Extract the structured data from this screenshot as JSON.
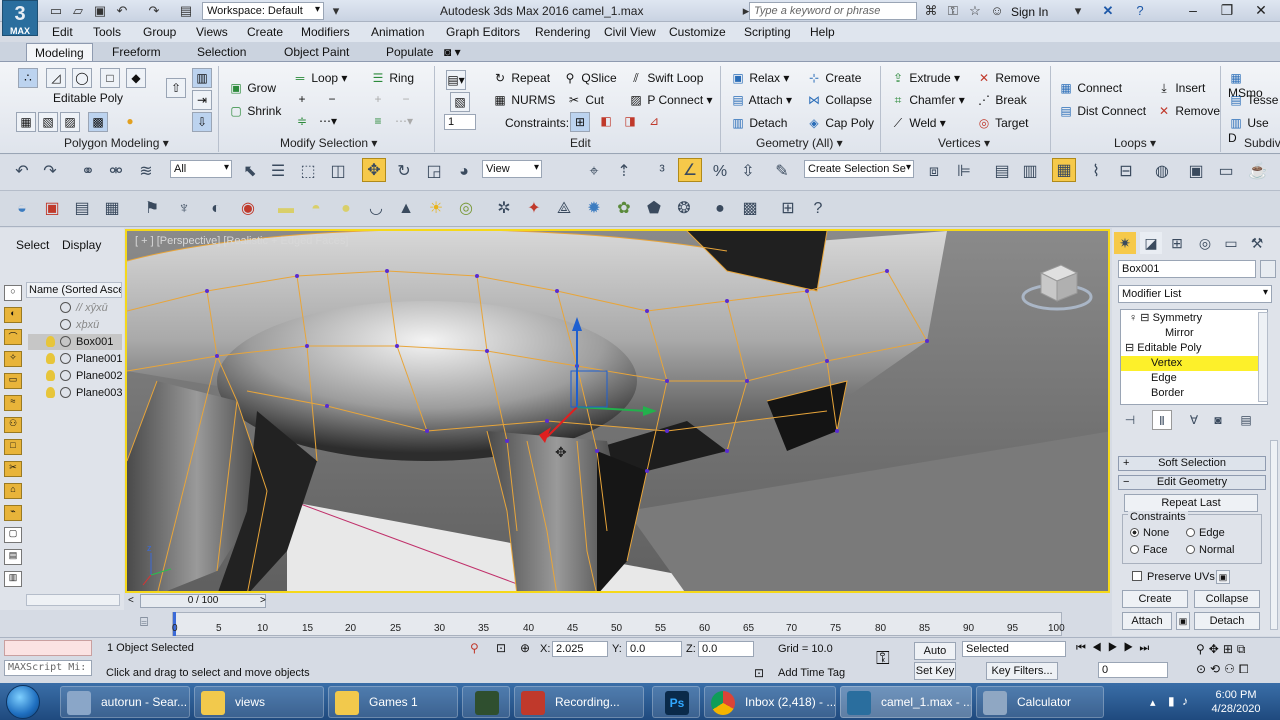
{
  "app": {
    "logo_text": "MAX",
    "window_title": "Autodesk 3ds Max 2016     camel_1.max"
  },
  "quick_access": {
    "workspace": "Workspace: Default"
  },
  "title_right": {
    "search_placeholder": "Type a keyword or phrase",
    "sign_in": "Sign In"
  },
  "menu": [
    "Edit",
    "Tools",
    "Group",
    "Views",
    "Create",
    "Modifiers",
    "Animation",
    "Graph Editors",
    "Rendering",
    "Civil View",
    "Customize",
    "Scripting",
    "Help"
  ],
  "ribbon_tabs": [
    "Modeling",
    "Freeform",
    "Selection",
    "Object Paint",
    "Populate"
  ],
  "ribbon": {
    "editable_poly": "Editable Poly",
    "grow": "Grow",
    "shrink": "Shrink",
    "loop": "Loop",
    "ring": "Ring",
    "spinner_value": "1",
    "repeat": "Repeat",
    "qslice": "QSlice",
    "swift_loop": "Swift Loop",
    "nurms": "NURMS",
    "cut": "Cut",
    "p_connect": "P Connect",
    "constraints": "Constraints:",
    "relax": "Relax",
    "create": "Create",
    "attach": "Attach",
    "collapse": "Collapse",
    "detach": "Detach",
    "cap_poly": "Cap Poly",
    "extrude": "Extrude",
    "remove": "Remove",
    "chamfer": "Chamfer",
    "break": "Break",
    "weld": "Weld",
    "target": "Target",
    "connect": "Connect",
    "dist_connect": "Dist Connect",
    "insert": "Insert",
    "remove2": "Remove",
    "msmooth": "MSmo",
    "tessellate": "Tesse",
    "use_d": "Use D"
  },
  "ribbon_groups": [
    "Polygon Modeling",
    "Modify Selection",
    "Edit",
    "Geometry (All)",
    "Vertices",
    "Loops",
    "Subdiv"
  ],
  "toolbar": {
    "filter": "All",
    "ref_coord": "View",
    "named_sel": "Create Selection Se"
  },
  "left_panel": {
    "tab_select": "Select",
    "tab_display": "Display",
    "name_header": "Name (Sorted Ascen",
    "items": [
      "// xŷxū",
      "xþxū",
      "Box001",
      "Plane001",
      "Plane002",
      "Plane003"
    ]
  },
  "viewport": {
    "label": "[ + ] [Perspective] [Realistic + Edged Faces]"
  },
  "command_panel": {
    "object_name": "Box001",
    "modifier_list": "Modifier List",
    "stack": [
      "Symmetry",
      "Mirror",
      "Editable Poly",
      "Vertex",
      "Edge",
      "Border"
    ],
    "soft_selection": "Soft Selection",
    "edit_geometry": "Edit Geometry",
    "repeat_last": "Repeat Last",
    "constraints_label": "Constraints",
    "c_none": "None",
    "c_edge": "Edge",
    "c_face": "Face",
    "c_normal": "Normal",
    "preserve_uvs": "Preserve UVs",
    "create": "Create",
    "collapse": "Collapse",
    "attach": "Attach",
    "detach": "Detach"
  },
  "timeline": {
    "slider": "0 / 100",
    "ticks": [
      "0",
      "5",
      "10",
      "15",
      "20",
      "25",
      "30",
      "35",
      "40",
      "45",
      "50",
      "55",
      "60",
      "65",
      "70",
      "75",
      "80",
      "85",
      "90",
      "95",
      "100"
    ]
  },
  "status": {
    "maxscript": "MAXScript Mi:",
    "selected": "1 Object Selected",
    "prompt": "Click and drag to select and move objects",
    "x": "2.025",
    "y": "0.0",
    "z": "0.0",
    "grid": "Grid = 10.0",
    "add_time_tag": "Add Time Tag",
    "auto_key": "Auto Key",
    "set_key": "Set Key",
    "key_mode": "Selected",
    "key_filters": "Key Filters...",
    "frame": "0"
  },
  "taskbar": {
    "items": [
      "autorun - Sear...",
      "views",
      "Games 1",
      "",
      "Recording...",
      "",
      "Inbox (2,418) - ...",
      "camel_1.max - ...",
      "Calculator"
    ],
    "time": "6:00 PM",
    "date": "4/28/2020"
  },
  "colors": {
    "viewport_border": "#f5d81a",
    "highlight": "#fdf02a",
    "wire": "#e8a53a",
    "vertex": "#5a2bd0"
  }
}
